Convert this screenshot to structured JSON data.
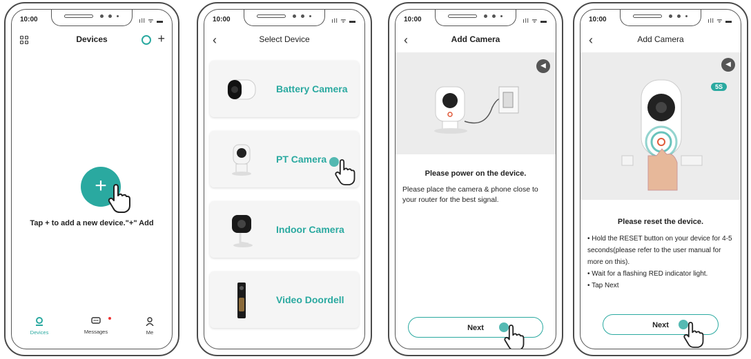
{
  "status": {
    "time": "10:00",
    "icons": "ıll ᯤ ▬"
  },
  "phone1": {
    "title": "Devices",
    "add_symbol": "+",
    "tap_text": "Tap + to add a new device.\"+\" Add",
    "tabs": [
      {
        "label": "Devices",
        "icon": "person-pin-icon"
      },
      {
        "label": "Messages",
        "icon": "message-icon"
      },
      {
        "label": "Me",
        "icon": "person-icon"
      }
    ],
    "accent": "#2aa9a0"
  },
  "phone2": {
    "title": "Select Device",
    "devices": [
      {
        "label": "Battery Camera"
      },
      {
        "label": "PT Camera"
      },
      {
        "label": "Indoor Camera"
      },
      {
        "label": "Video Doordell"
      }
    ]
  },
  "phone3": {
    "title": "Add Camera",
    "heading": "Please power on the device.",
    "body": "Please place the camera & phone close to your router for the best signal.",
    "next_label": "Next"
  },
  "phone4": {
    "title": "Add Camera",
    "badge": "5S",
    "heading": "Please reset the device.",
    "bullets": [
      "Hold the RESET button on your device for 4-5 seconds(please refer to the user manual for more on this).",
      "Wait for a flashing RED indicator light.",
      "Tap Next"
    ],
    "next_label": "Next"
  }
}
